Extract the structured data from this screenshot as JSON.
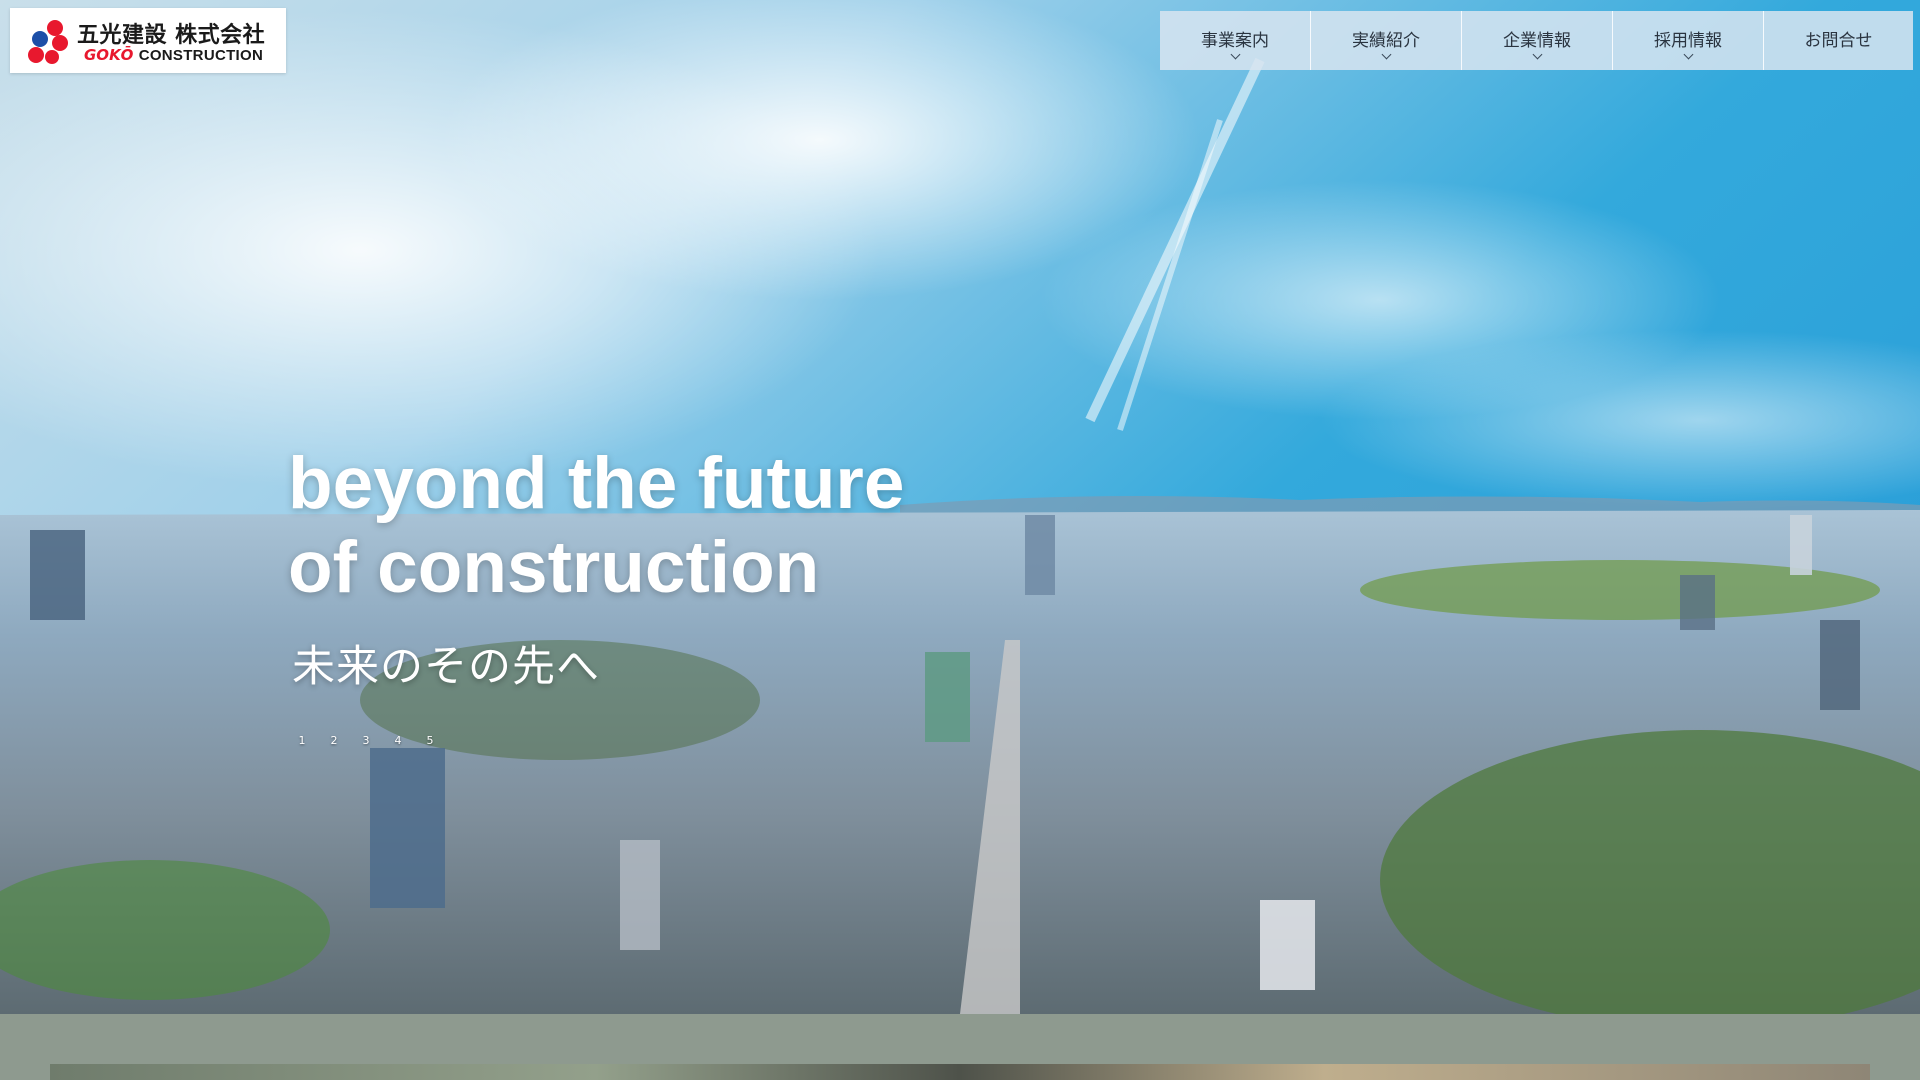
{
  "logo": {
    "name_ja": "五光建設 株式会社",
    "brand_en": "GOKŌ",
    "brand_en_suffix": "CONSTRUCTION",
    "colors": {
      "brand_red": "#e8182e",
      "brand_blue": "#1c4fa8"
    }
  },
  "nav": {
    "items": [
      {
        "label": "事業案内",
        "has_dropdown": true
      },
      {
        "label": "実績紹介",
        "has_dropdown": true
      },
      {
        "label": "企業情報",
        "has_dropdown": true
      },
      {
        "label": "採用情報",
        "has_dropdown": true
      },
      {
        "label": "お問合せ",
        "has_dropdown": false
      }
    ]
  },
  "hero": {
    "headline_line1": "beyond the future",
    "headline_line2": "of construction",
    "subtitle": "未来のその先へ",
    "pager": [
      "1",
      "2",
      "3",
      "4",
      "5"
    ]
  }
}
